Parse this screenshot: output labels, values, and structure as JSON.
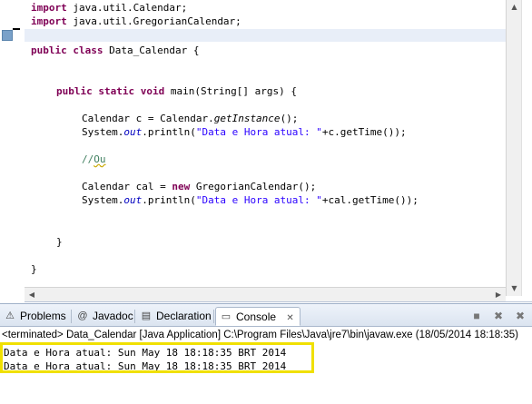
{
  "editor": {
    "lines": {
      "l1_import": "import",
      "l1_rest": " java.util.Calendar;",
      "l2_import": "import",
      "l2_rest": " java.util.GregorianCalendar;",
      "l4_public": "public",
      "l4_class": "class",
      "l4_rest": " Data_Calendar {",
      "l6_public": "public",
      "l6_static": "static",
      "l6_void": "void",
      "l6_rest": " main(String[] args) {",
      "l8_a": "Calendar c = Calendar.",
      "l8_method": "getInstance",
      "l8_b": "();",
      "l9_a": "System.",
      "l9_field": "out",
      "l9_b": ".println(",
      "l9_str": "\"Data e Hora atual: \"",
      "l9_c": "+c.getTime());",
      "l11_cmt_prefix": "//",
      "l11_cmt_word": "Ou",
      "l13_a": "Calendar cal = ",
      "l13_new": "new",
      "l13_b": " GregorianCalendar();",
      "l14_a": "System.",
      "l14_field": "out",
      "l14_b": ".println(",
      "l14_str": "\"Data e Hora atual: \"",
      "l14_c": "+cal.getTime());",
      "l17_brace": "}",
      "l19_brace": "}"
    },
    "colors": {
      "keyword": "#7f0055",
      "string": "#2a00ff",
      "comment": "#3f7f5f",
      "field": "#0000c0",
      "current_line": "#e8eef8"
    }
  },
  "panel": {
    "tabs": [
      {
        "label": "Problems",
        "icon": "problems-icon"
      },
      {
        "label": "Javadoc",
        "icon": "javadoc-icon"
      },
      {
        "label": "Declaration",
        "icon": "declaration-icon"
      },
      {
        "label": "Console",
        "icon": "console-icon",
        "active": true
      }
    ],
    "status": "<terminated> Data_Calendar [Java Application] C:\\Program Files\\Java\\jre7\\bin\\javaw.exe (18/05/2014 18:18:35)",
    "output": [
      "Data e Hora atual: Sun May 18 18:18:35 BRT 2014",
      "Data e Hora atual: Sun May 18 18:18:35 BRT 2014"
    ],
    "highlight_color": "#f0e000"
  }
}
